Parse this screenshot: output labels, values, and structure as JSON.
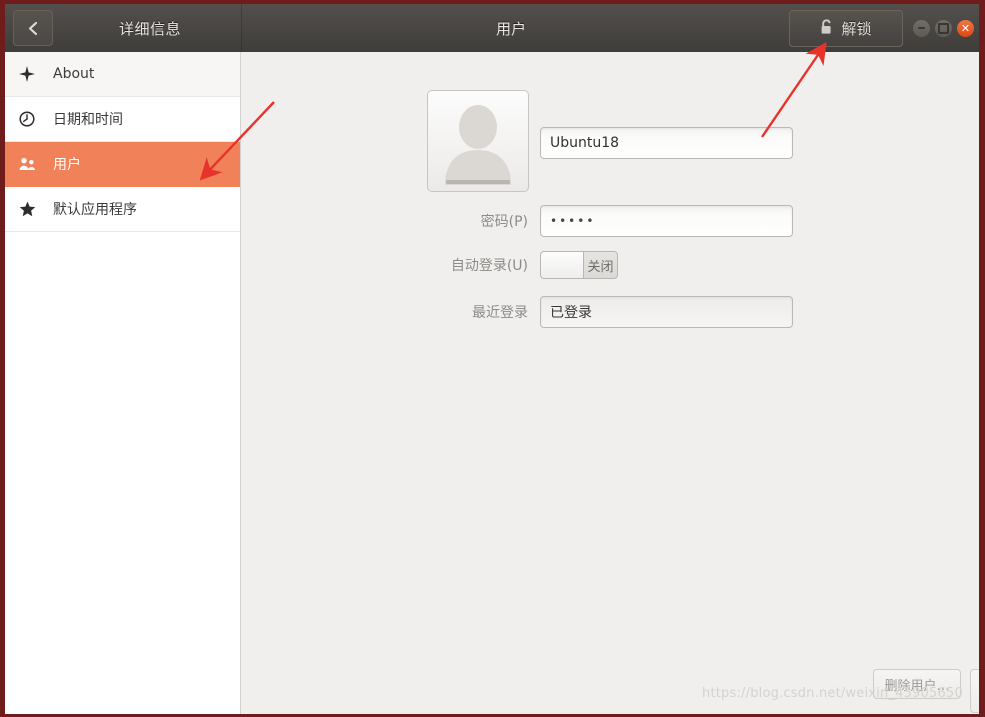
{
  "window": {
    "panel_title": "详细信息",
    "window_title": "用户",
    "back_icon": "chevron-left-icon",
    "unlock_label": "解锁",
    "unlock_icon": "lock-icon",
    "controls": {
      "minimize": "minimize-icon",
      "maximize": "maximize-icon",
      "close": "close-icon",
      "close_color": "#dd4814"
    }
  },
  "sidebar": {
    "active_color": "#f08158",
    "items": [
      {
        "label": "About",
        "icon": "sparkle-icon",
        "active": false
      },
      {
        "label": "日期和时间",
        "icon": "clock-icon",
        "active": false
      },
      {
        "label": "用户",
        "icon": "users-icon",
        "active": true
      },
      {
        "label": "默认应用程序",
        "icon": "star-icon",
        "active": false
      }
    ]
  },
  "main": {
    "avatar_icon": "user-avatar-placeholder",
    "name_value": "Ubuntu18",
    "password_label": "密码(P)",
    "password_value": "•••••",
    "autologin_label": "自动登录(U)",
    "autologin_state": "关闭",
    "lastlogin_label": "最近登录",
    "lastlogin_value": "已登录",
    "delete_user_label": "删除用户…"
  },
  "watermark": {
    "text": "https://blog.csdn.net/weixin_45905650"
  },
  "annotations": {
    "arrow_to_users": "red-arrow-pointing-to-users-item",
    "arrow_to_unlock": "red-arrow-pointing-to-unlock-button",
    "color": "#e8332a"
  }
}
